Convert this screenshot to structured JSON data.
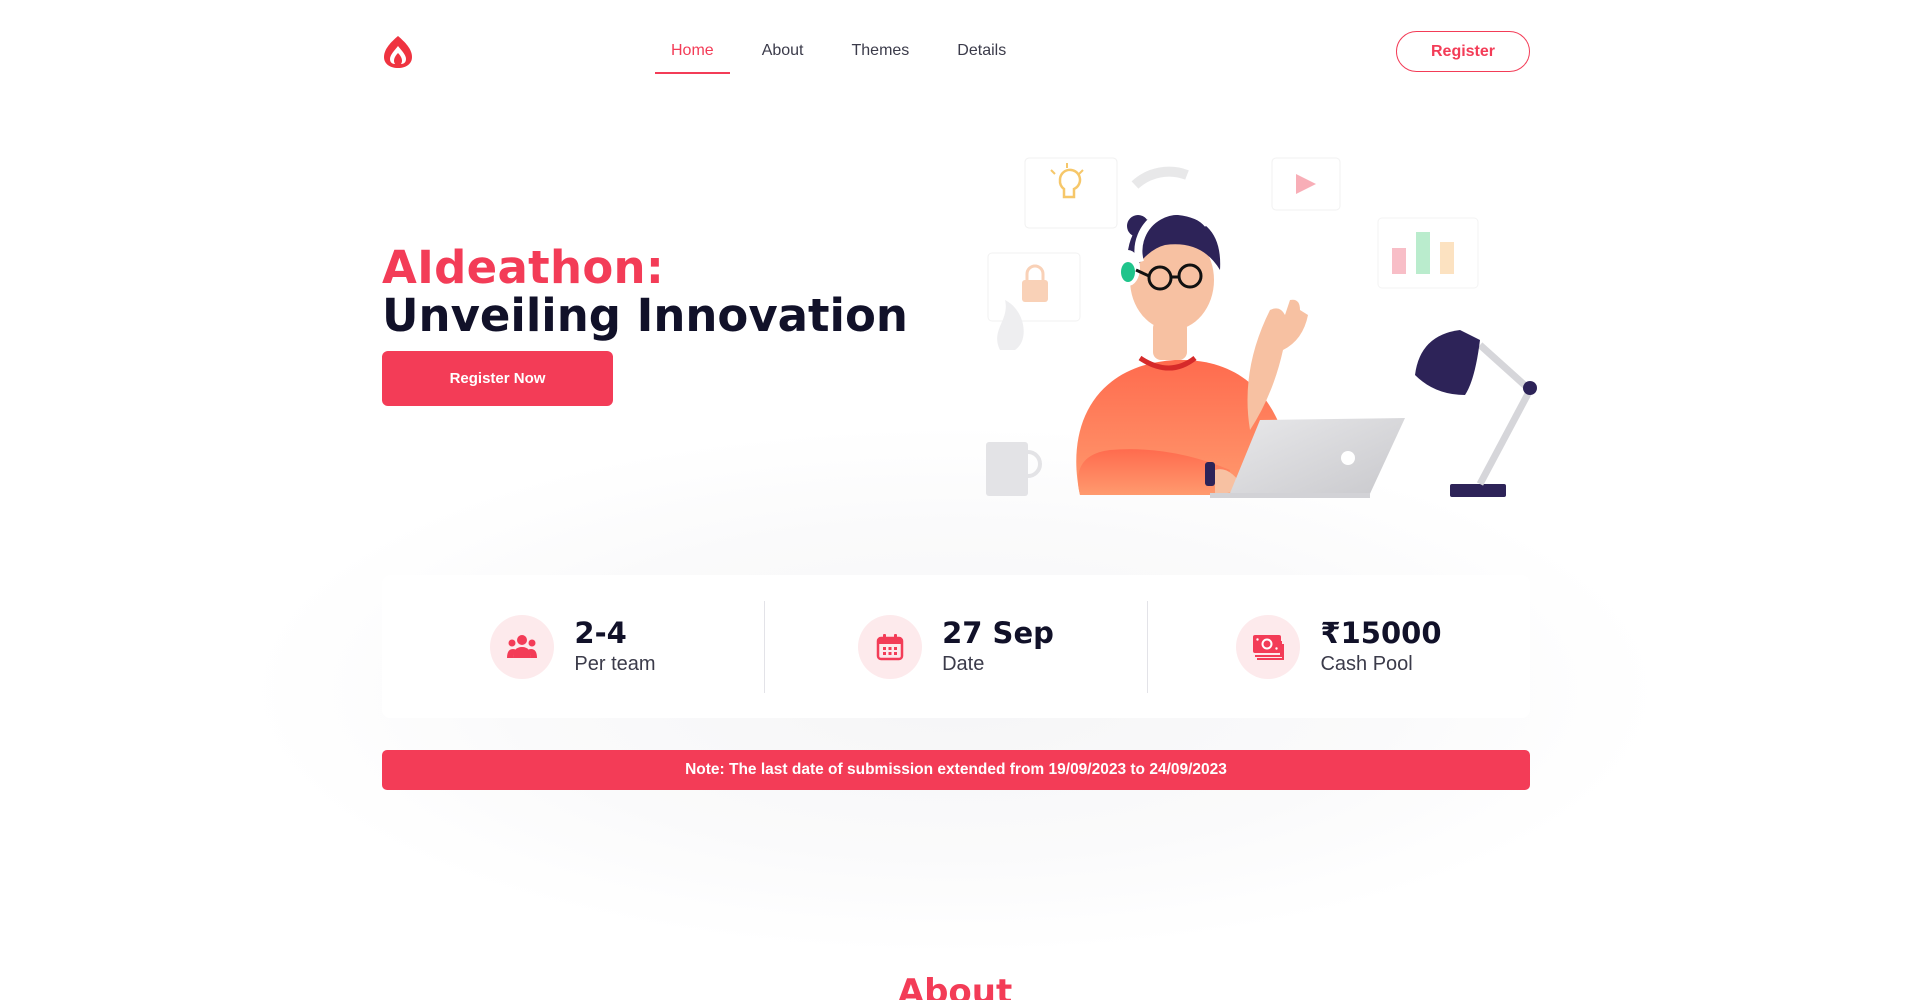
{
  "nav": {
    "links": [
      "Home",
      "About",
      "Themes",
      "Details"
    ],
    "active": "Home",
    "register_label": "Register"
  },
  "hero": {
    "title_accent": "AIdeathon:",
    "title_main": "Unveiling Innovation",
    "cta_label": "Register Now"
  },
  "stats": [
    {
      "value": "2-4",
      "label": "Per team",
      "icon": "people-icon"
    },
    {
      "value": "27 Sep",
      "label": "Date",
      "icon": "calendar-icon"
    },
    {
      "value": "₹15000",
      "label": "Cash Pool",
      "icon": "money-icon"
    }
  ],
  "note": "Note: The last date of submission extended from 19/09/2023 to 24/09/2023",
  "section": {
    "title": "About"
  },
  "colors": {
    "accent": "#f33c57",
    "text": "#111129",
    "icon_bg": "#fdeaec"
  }
}
